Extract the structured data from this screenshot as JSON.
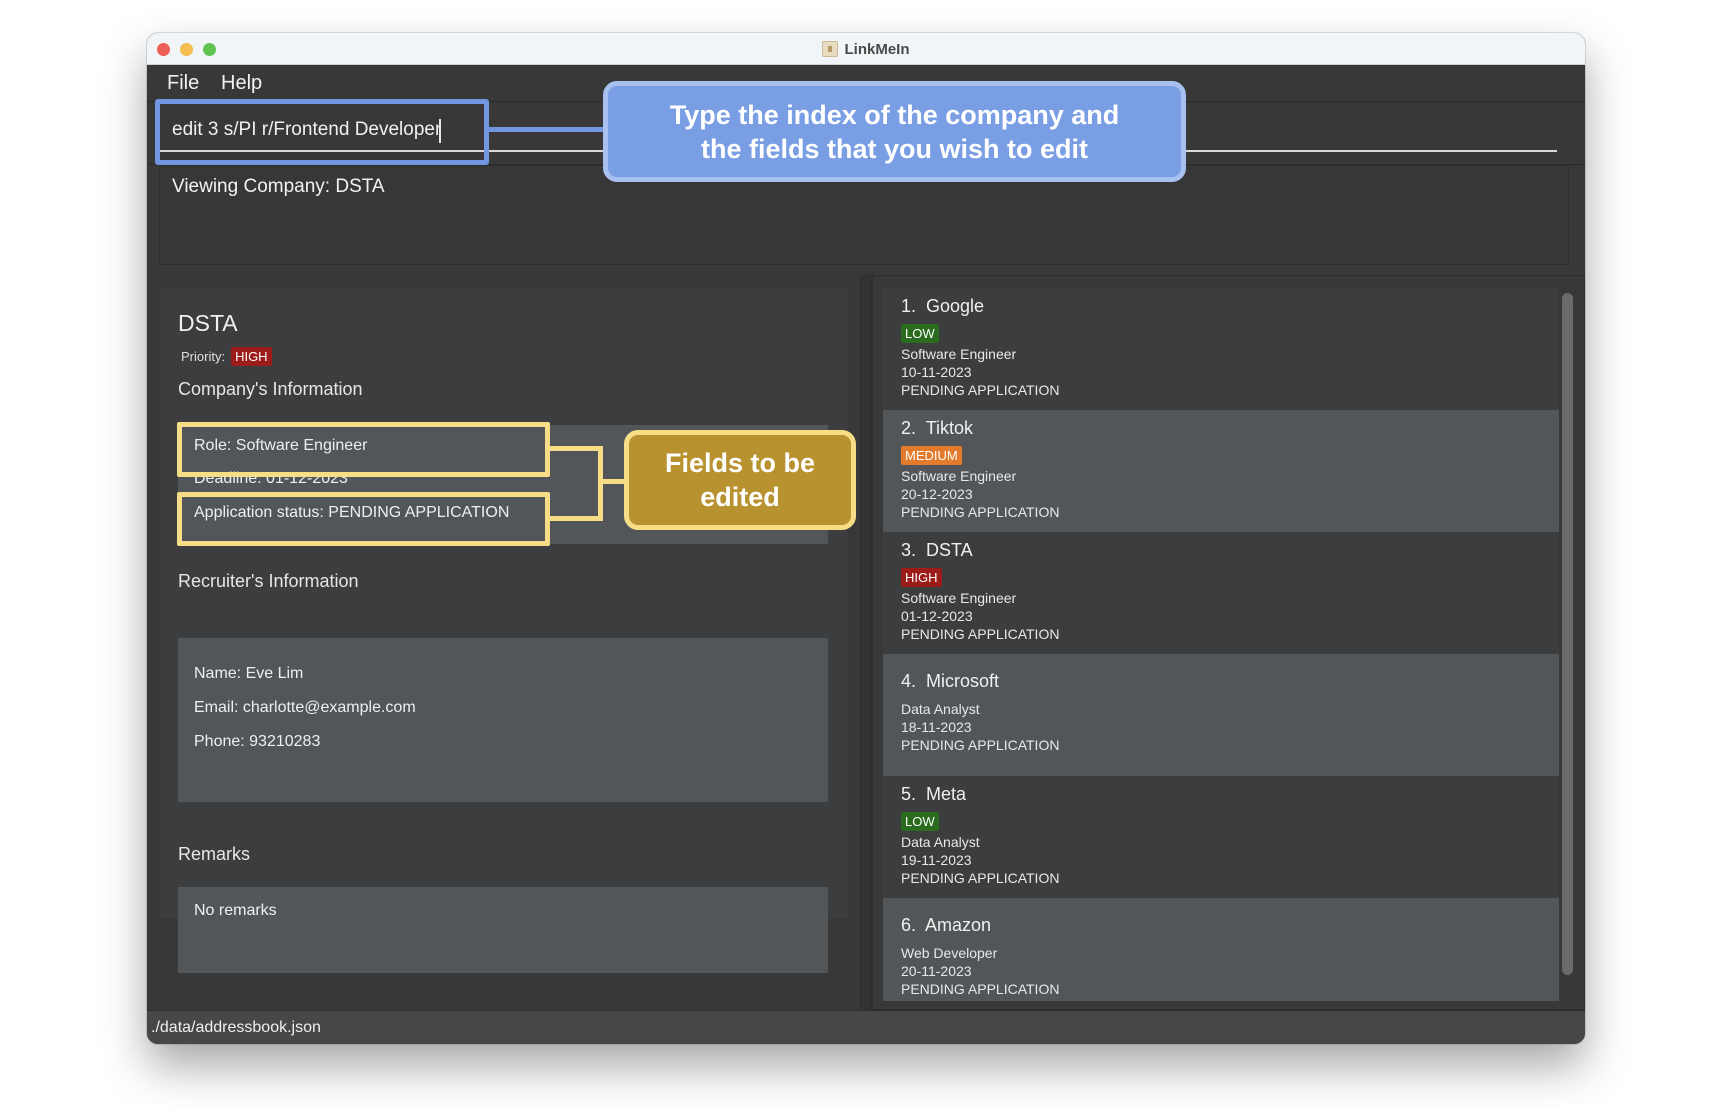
{
  "window": {
    "title": "LinkMeIn"
  },
  "menu": {
    "items": [
      {
        "label": "File"
      },
      {
        "label": "Help"
      }
    ]
  },
  "command": {
    "value": "edit 3 s/PI r/Frontend Developer"
  },
  "result": {
    "text": "Viewing Company: DSTA"
  },
  "detail": {
    "company_name": "DSTA",
    "priority_label": "Priority:",
    "priority": "HIGH",
    "company_info_title": "Company's Information",
    "role": "Role: Software Engineer",
    "deadline": "Deadline: 01-12-2023",
    "status": "Application status: PENDING APPLICATION",
    "recruiter_info_title": "Recruiter's Information",
    "recruiter_name": "Name: Eve Lim",
    "recruiter_email": "Email: charlotte@example.com",
    "recruiter_phone": "Phone: 93210283",
    "remarks_title": "Remarks",
    "remarks": "No remarks"
  },
  "companies": [
    {
      "title": "1.  Google",
      "priority": "LOW",
      "role": "Software Engineer",
      "deadline": "10-11-2023",
      "status": "PENDING APPLICATION"
    },
    {
      "title": "2.  Tiktok",
      "priority": "MEDIUM",
      "role": "Software Engineer",
      "deadline": "20-12-2023",
      "status": "PENDING APPLICATION"
    },
    {
      "title": "3.  DSTA",
      "priority": "HIGH",
      "role": "Software Engineer",
      "deadline": "01-12-2023",
      "status": "PENDING APPLICATION"
    },
    {
      "title": "4.  Microsoft",
      "priority": null,
      "role": "Data Analyst",
      "deadline": "18-11-2023",
      "status": "PENDING APPLICATION"
    },
    {
      "title": "5.  Meta",
      "priority": "LOW",
      "role": "Data Analyst",
      "deadline": "19-11-2023",
      "status": "PENDING APPLICATION"
    },
    {
      "title": "6.  Amazon",
      "priority": null,
      "role": "Web Developer",
      "deadline": "20-11-2023",
      "status": "PENDING APPLICATION"
    }
  ],
  "statusbar": {
    "path": "./data/addressbook.json"
  },
  "annotations": {
    "command_callout": "Type the index of the company and the fields that you wish to edit",
    "fields_callout": "Fields to be edited"
  },
  "colors": {
    "priority_high": "#9b1c18",
    "priority_medium": "#e47a2c",
    "priority_low": "#2a6b1e",
    "annotation_blue": "#7a9ee4",
    "annotation_gold": "#b8922f"
  }
}
